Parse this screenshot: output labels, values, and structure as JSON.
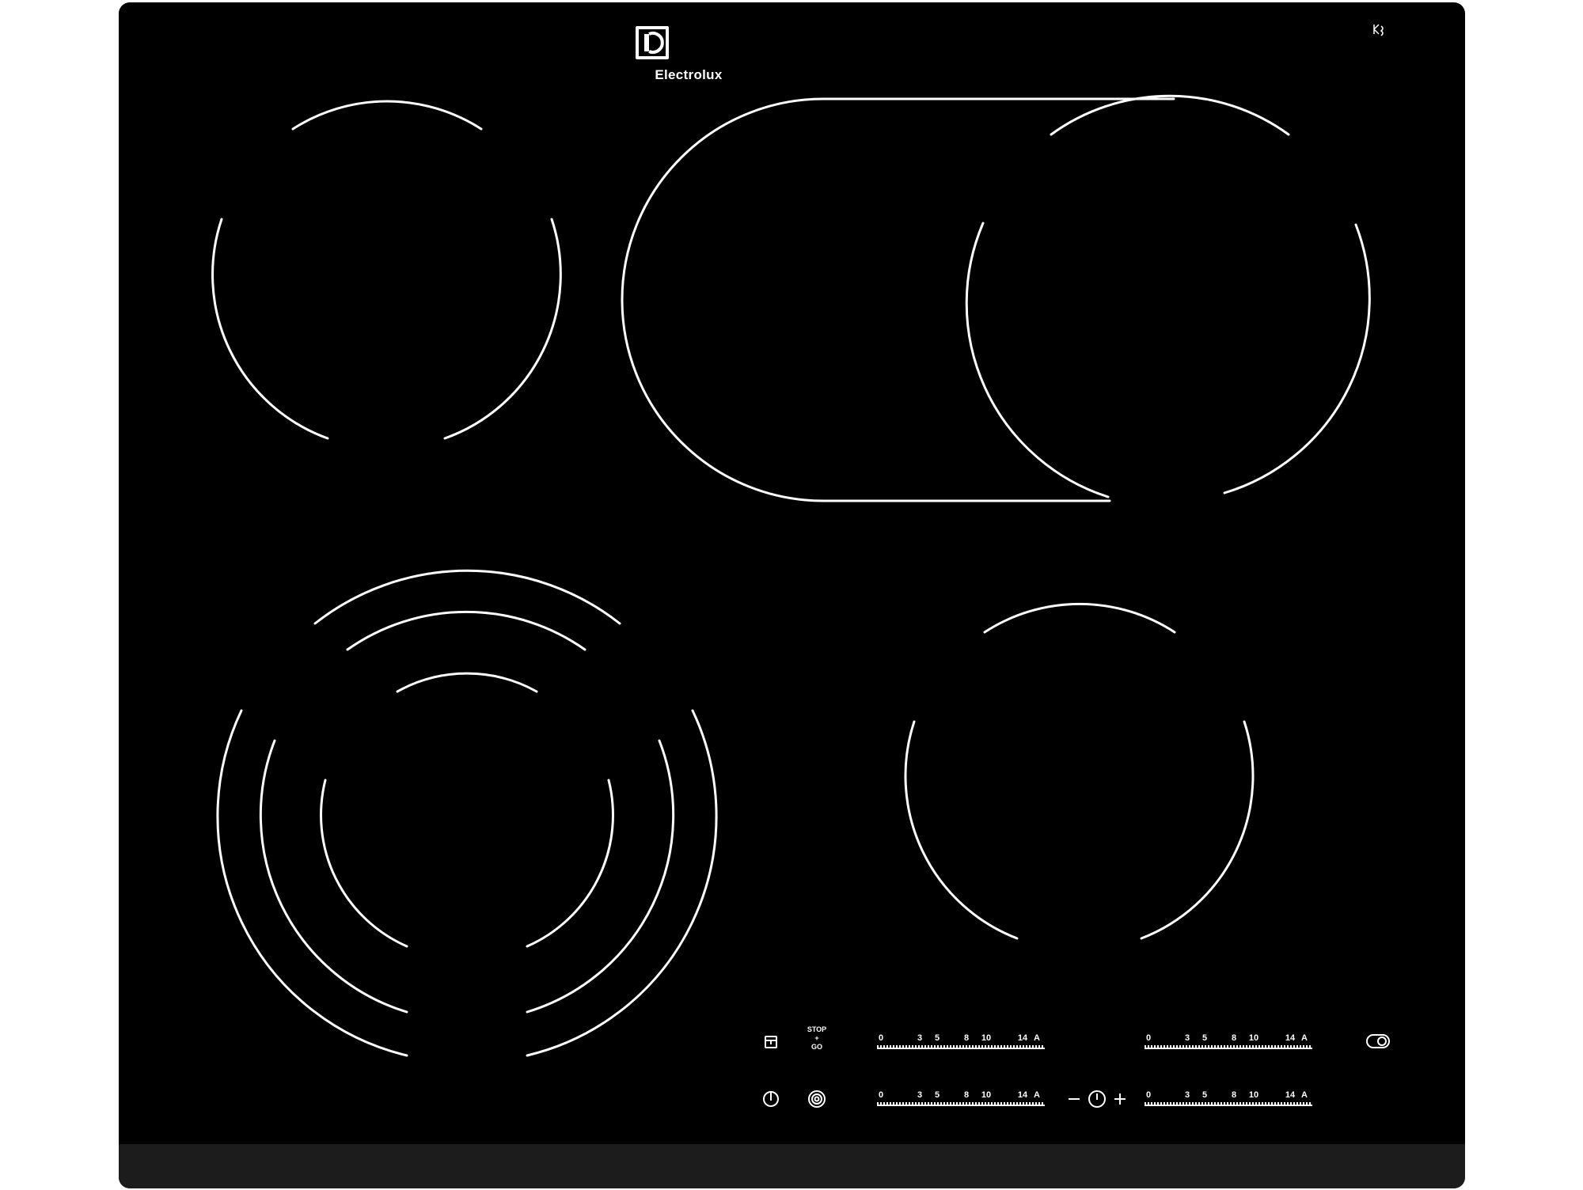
{
  "brand": {
    "name": "Electrolux"
  },
  "controls": {
    "stop_go": {
      "line1": "STOP",
      "line2": "+",
      "line3": "GO"
    },
    "timer": {
      "minus": "–",
      "plus": "+"
    }
  },
  "sliders": [
    {
      "id": "front-left",
      "labels": [
        "0",
        "3",
        "5",
        "8",
        "10",
        "14",
        "A"
      ]
    },
    {
      "id": "rear-left",
      "labels": [
        "0",
        "3",
        "5",
        "8",
        "10",
        "14",
        "A"
      ]
    },
    {
      "id": "front-right",
      "labels": [
        "0",
        "3",
        "5",
        "8",
        "10",
        "14",
        "A"
      ]
    },
    {
      "id": "rear-right",
      "labels": [
        "0",
        "3",
        "5",
        "8",
        "10",
        "14",
        "A"
      ]
    }
  ],
  "icons": [
    "electrolux-logo-icon",
    "hot-surface-icon",
    "lock-icon",
    "power-icon",
    "dual-zone-icon",
    "timer-icon",
    "bridge-zone-icon"
  ],
  "colors": {
    "glass": "#000000",
    "markings": "#ffffff",
    "edge": "#1c1c1c"
  }
}
